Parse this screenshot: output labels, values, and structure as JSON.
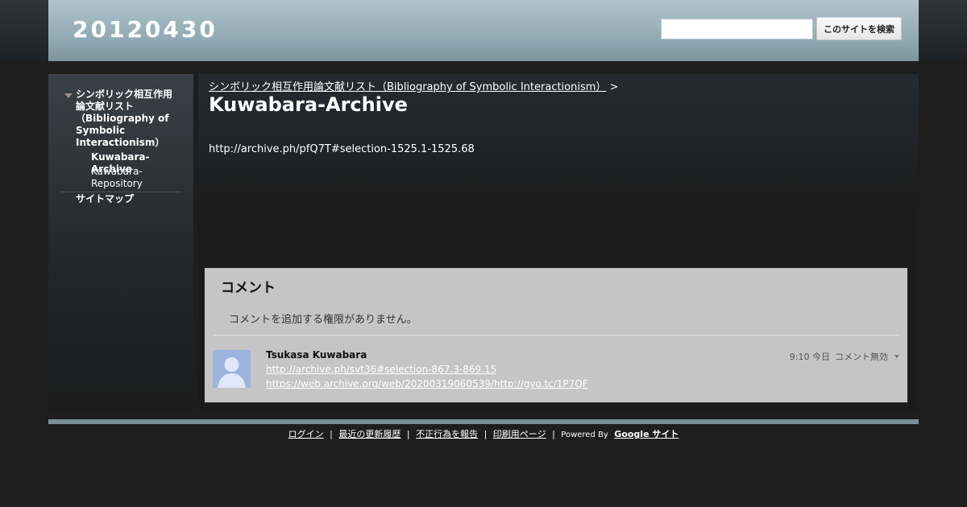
{
  "header": {
    "site_title": "20120430",
    "search_placeholder": "",
    "search_button_label": "このサイトを検索"
  },
  "sidebar": {
    "items": [
      {
        "label": "シンボリック相互作用論文献リスト（Bibliography of Symbolic Interactionism）",
        "expanded": true
      },
      {
        "label": "Kuwabara-Archive",
        "current": true
      },
      {
        "label": "Kuwabara-Repository"
      },
      {
        "label": "サイトマップ"
      }
    ]
  },
  "main": {
    "breadcrumb_link": "シンボリック相互作用論文献リスト（Bibliography of Symbolic Interactionism）",
    "breadcrumb_sep": ">",
    "page_title": "Kuwabara-Archive",
    "body_text": "http://archive.ph/pfQ7T#selection-1525.1-1525.68"
  },
  "comments": {
    "title": "コメント",
    "no_permission": "コメントを追加する権限がありません。",
    "items": [
      {
        "author": "Tsukasa Kuwabara",
        "time": "9:10 今日",
        "status": "コメント無効",
        "links": [
          "http://archive.ph/svt36#selection-867.3-869.15",
          "https://web.archive.org/web/20200319060539/http://gyo.tc/1P7QF"
        ]
      }
    ]
  },
  "footer": {
    "login": "ログイン",
    "recent": "最近の更新履歴",
    "report": "不正行為を報告",
    "print": "印刷用ページ",
    "powered_by": "Powered By",
    "google_sites": "Google サイト"
  },
  "colors": {
    "header_accent": "#8fa7b1",
    "page_bg": "#1e1e1e",
    "comments_bg": "#c5c5c5",
    "footer_line": "#7c8f98"
  }
}
